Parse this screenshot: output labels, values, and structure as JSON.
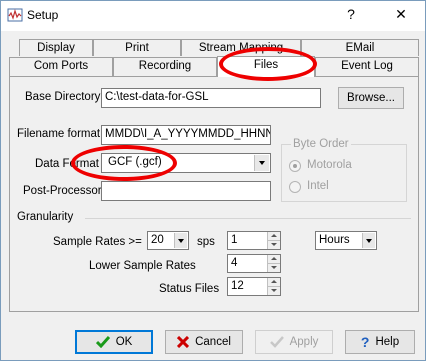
{
  "window": {
    "title": "Setup",
    "help_glyph": "?",
    "close_glyph": "✕"
  },
  "tabs": {
    "row1": [
      {
        "label": "Display"
      },
      {
        "label": "Print"
      },
      {
        "label": "Stream Mapping"
      },
      {
        "label": "EMail"
      }
    ],
    "row2": [
      {
        "label": "Com Ports"
      },
      {
        "label": "Recording"
      },
      {
        "label": "Files",
        "active": true
      },
      {
        "label": "Event Log"
      }
    ]
  },
  "files": {
    "base_directory_label": "Base Directory",
    "base_directory_value": "C:\\test-data-for-GSL",
    "browse_label": "Browse...",
    "filename_format_label": "Filename format",
    "filename_format_value": "MMDD\\I_A_YYYYMMDD_HHNN",
    "data_format_label": "Data Format",
    "data_format_value": "GCF (.gcf)",
    "post_processor_label": "Post-Processor",
    "post_processor_value": "",
    "byte_order": {
      "title": "Byte Order",
      "options": [
        "Motorola",
        "Intel"
      ],
      "selected": "Motorola"
    }
  },
  "granularity": {
    "title": "Granularity",
    "sample_rates_label": "Sample Rates >=",
    "sample_rate_value": "20",
    "sps_label": "sps",
    "sps_value": "1",
    "unit_value": "Hours",
    "lower_sample_rates_label": "Lower Sample Rates",
    "lower_sample_rates_value": "4",
    "status_files_label": "Status Files",
    "status_files_value": "12"
  },
  "buttons": {
    "ok": "OK",
    "cancel": "Cancel",
    "apply": "Apply",
    "help": "Help"
  },
  "colors": {
    "highlight": "#ee0000",
    "ok_check": "#1a9a1a",
    "cancel_x": "#cc0000",
    "help_icon": "#1f5fbf"
  }
}
